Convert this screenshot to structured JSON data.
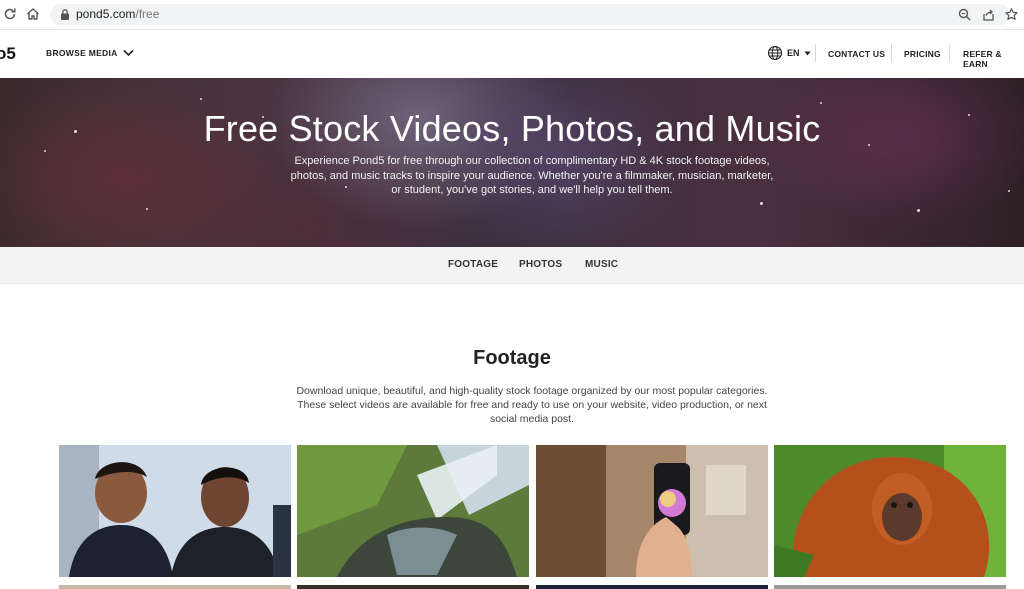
{
  "browser": {
    "url_host": "pond5.com",
    "url_path": "/free"
  },
  "header": {
    "logo": "o5",
    "browse_label": "BROWSE MEDIA",
    "lang_label": "EN",
    "links": {
      "contact": "CONTACT US",
      "pricing": "PRICING",
      "refer": "REFER & EARN"
    }
  },
  "hero": {
    "title": "Free Stock Videos, Photos, and Music",
    "subtitle": "Experience Pond5 for free through our collection of complimentary HD & 4K stock footage videos, photos, and music tracks to inspire your audience. Whether you're a filmmaker, musician, marketer, or student, you've got stories, and we'll help you tell them."
  },
  "tabs": [
    {
      "label": "FOOTAGE"
    },
    {
      "label": "PHOTOS"
    },
    {
      "label": "MUSIC"
    }
  ],
  "footage": {
    "title": "Footage",
    "description": "Download unique, beautiful, and high-quality stock footage organized by our most popular categories. These select videos are available for free and ready to use on your website, video production, or next social media post."
  },
  "colors": {
    "hero_text": "#ffffff",
    "tab_bar": "#f3f3f3",
    "omnibox": "#f1f3f4"
  }
}
